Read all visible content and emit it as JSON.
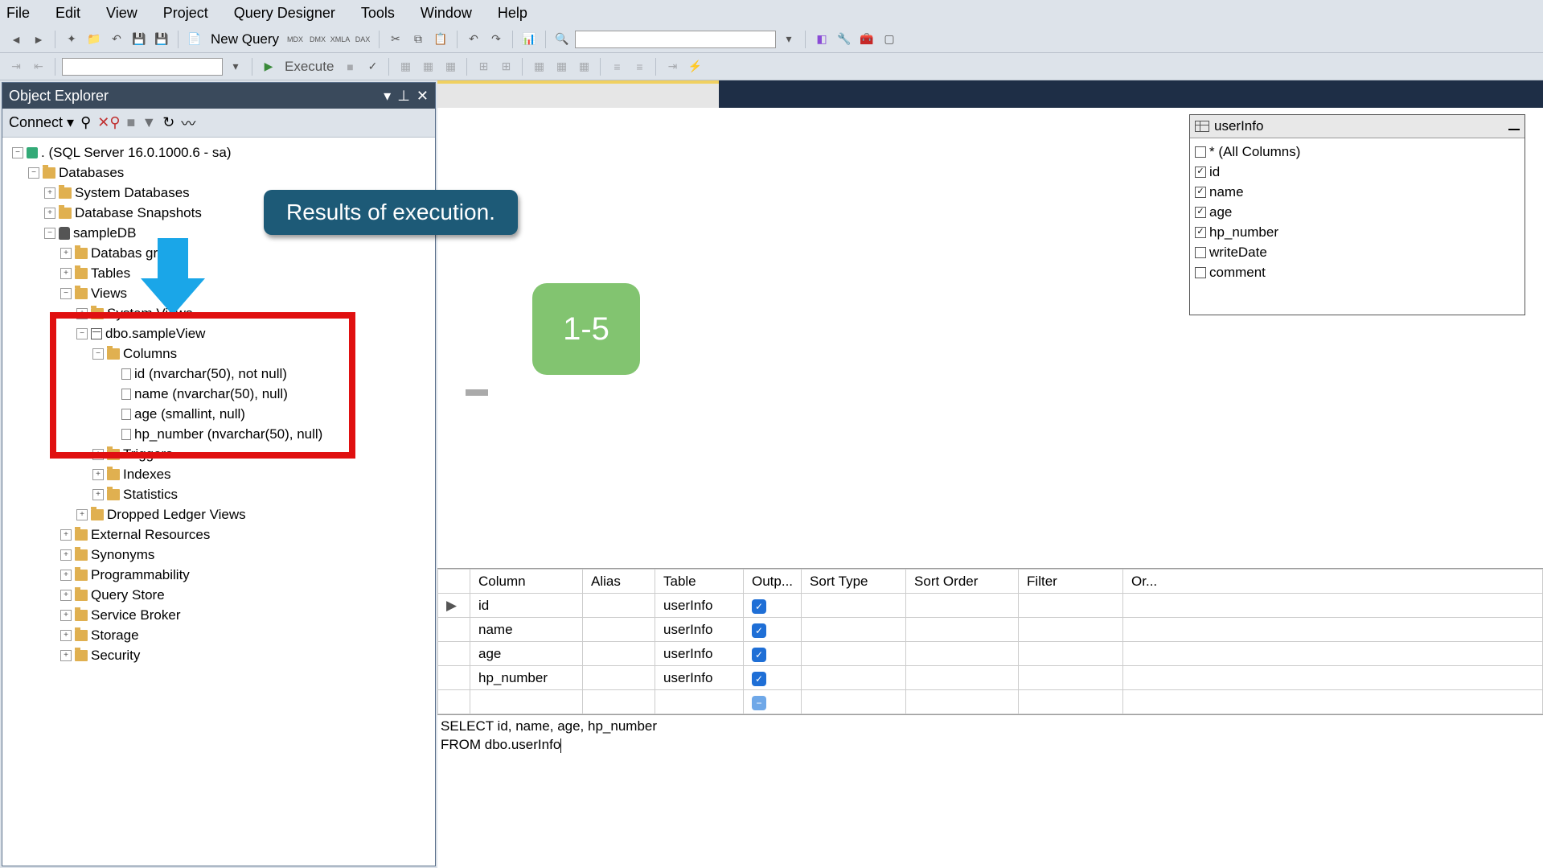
{
  "menu": {
    "file": "File",
    "edit": "Edit",
    "view": "View",
    "project": "Project",
    "query_designer": "Query Designer",
    "tools": "Tools",
    "window": "Window",
    "help": "Help"
  },
  "toolbar": {
    "new_query": "New Query",
    "execute": "Execute"
  },
  "sidebar": {
    "title": "Object Explorer",
    "connect": "Connect",
    "server": ". (SQL Server 16.0.1000.6 - sa)",
    "databases": "Databases",
    "system_db": "System Databases",
    "snapshots": "Database Snapshots",
    "sampledb": "sampleDB",
    "db_diagrams": "Databas        grams",
    "tables": "Tables",
    "views": "Views",
    "system_views": "System Views",
    "sampleview": "dbo.sampleView",
    "columns": "Columns",
    "col_id": "id (nvarchar(50), not null)",
    "col_name": "name (nvarchar(50), null)",
    "col_age": "age (smallint, null)",
    "col_hp": "hp_number (nvarchar(50), null)",
    "triggers": "Triggers",
    "indexes": "Indexes",
    "statistics": "Statistics",
    "dropped": "Dropped Ledger Views",
    "ext_res": "External Resources",
    "synonyms": "Synonyms",
    "programmability": "Programmability",
    "query_store": "Query Store",
    "service_broker": "Service Broker",
    "storage": "Storage",
    "security": "Security"
  },
  "designer": {
    "table_title": "userInfo",
    "cols": {
      "all": "* (All Columns)",
      "id": "id",
      "name": "name",
      "age": "age",
      "hp": "hp_number",
      "writedate": "writeDate",
      "comment": "comment"
    },
    "grid_headers": {
      "column": "Column",
      "alias": "Alias",
      "table": "Table",
      "output": "Outp...",
      "sort_type": "Sort Type",
      "sort_order": "Sort Order",
      "filter": "Filter",
      "or": "Or..."
    },
    "rows": [
      {
        "col": "id",
        "table": "userInfo"
      },
      {
        "col": "name",
        "table": "userInfo"
      },
      {
        "col": "age",
        "table": "userInfo"
      },
      {
        "col": "hp_number",
        "table": "userInfo"
      }
    ],
    "sql_line1": "SELECT id, name, age, hp_number",
    "sql_line2": "FROM   dbo.userInfo"
  },
  "annotations": {
    "callout": "Results of execution.",
    "badge": "1-5"
  }
}
